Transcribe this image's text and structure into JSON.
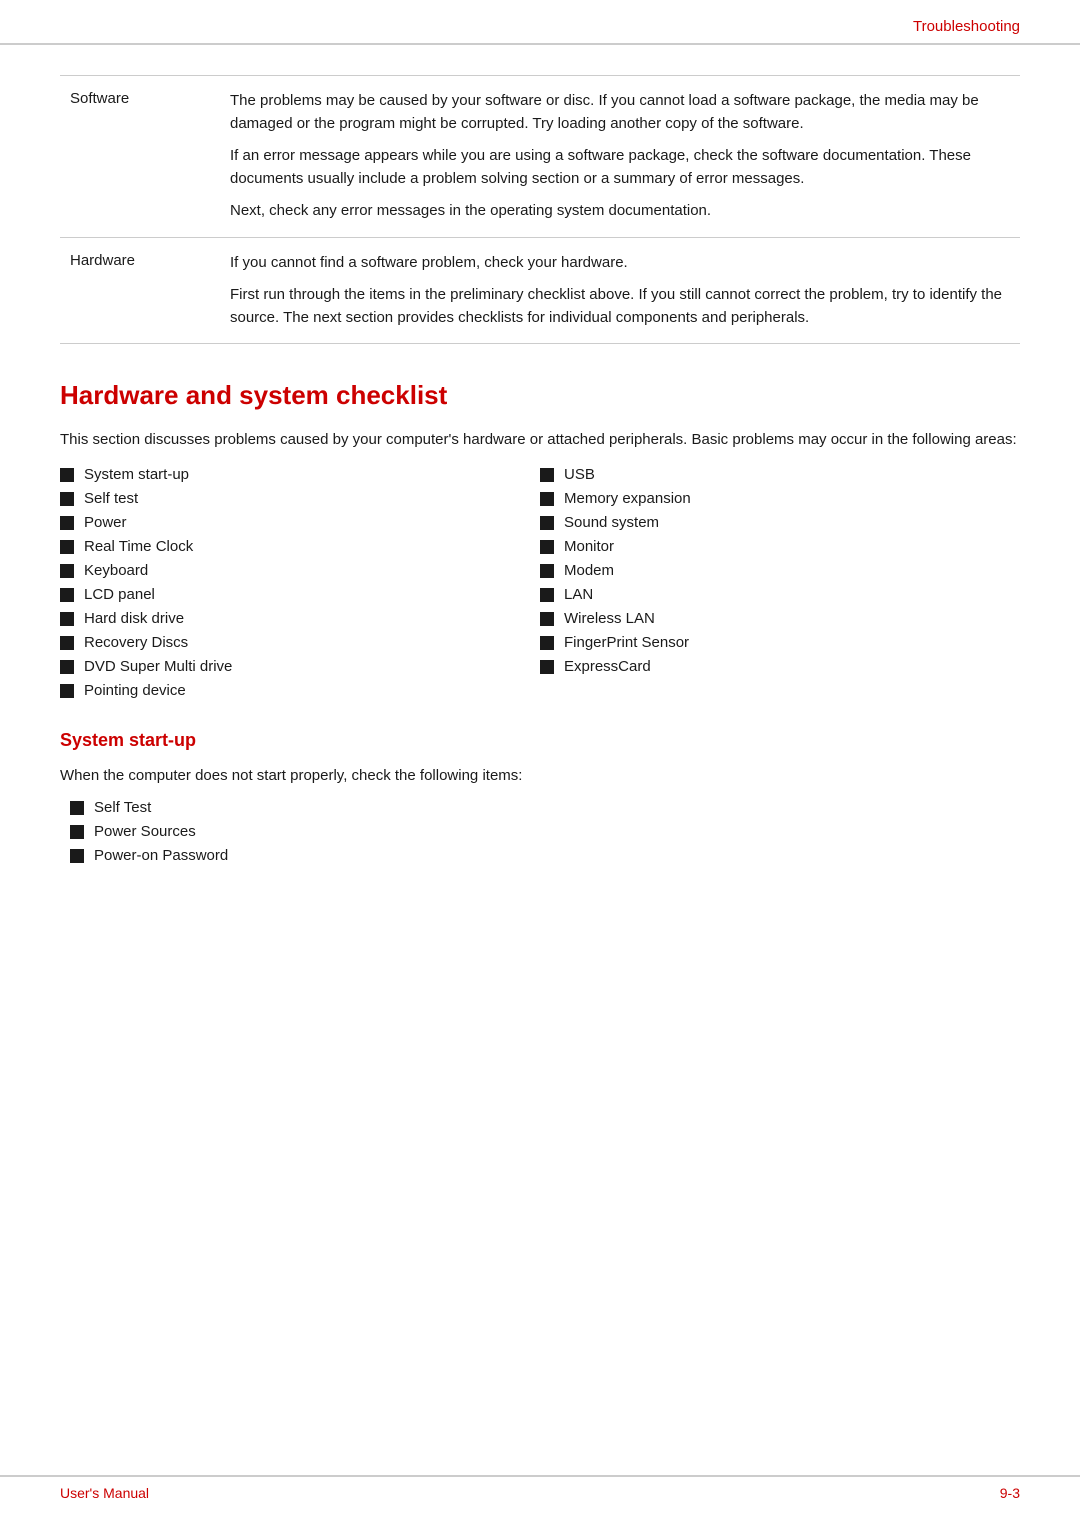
{
  "header": {
    "title": "Troubleshooting"
  },
  "table": {
    "rows": [
      {
        "label": "Software",
        "paragraphs": [
          "The problems may be caused by your software or disc. If you cannot load a software package, the media may be damaged or the program might be corrupted. Try loading another copy of the software.",
          "If an error message appears while you are using a software package, check the software documentation. These documents usually include a problem solving section or a summary of error messages.",
          "Next, check any error messages in the operating system documentation."
        ]
      },
      {
        "label": "Hardware",
        "paragraphs": [
          "If you cannot find a software problem, check your hardware.",
          "First run through the items in the preliminary checklist above. If you still cannot correct the problem, try to identify the source. The next section provides checklists for individual components and peripherals."
        ]
      }
    ]
  },
  "hardware_section": {
    "heading": "Hardware and system checklist",
    "intro": "This section discusses problems caused by your computer's hardware or attached peripherals. Basic problems may occur in the following areas:",
    "list_col1": [
      "System start-up",
      "Self test",
      "Power",
      "Real Time Clock",
      "Keyboard",
      "LCD panel",
      "Hard disk drive",
      "Recovery Discs",
      "DVD Super Multi drive",
      "Pointing device"
    ],
    "list_col2": [
      "USB",
      "Memory expansion",
      "Sound system",
      "Monitor",
      "Modem",
      "LAN",
      "Wireless LAN",
      "FingerPrint Sensor",
      "ExpressCard"
    ]
  },
  "system_startup": {
    "heading": "System start-up",
    "intro": "When the computer does not start properly, check the following items:",
    "items": [
      "Self Test",
      "Power Sources",
      "Power-on Password"
    ]
  },
  "footer": {
    "left": "User's Manual",
    "right": "9-3"
  }
}
